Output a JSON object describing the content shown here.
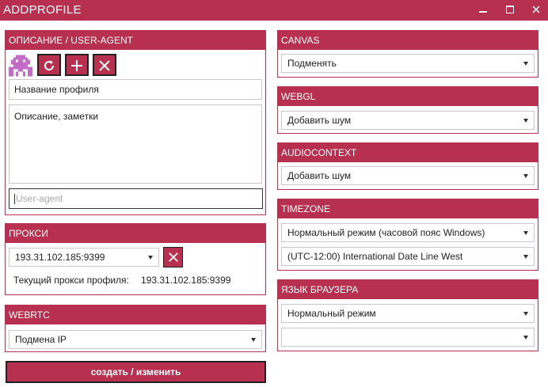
{
  "window": {
    "title": "ADDPROFILE",
    "minimize_glyph": "▬",
    "maximize_glyph": "☐",
    "close_glyph": "✕"
  },
  "description_panel": {
    "header": "ОПИСАНИЕ / USER-AGENT",
    "avatar_icon": "pixel-invader-icon",
    "profile_name_value": "Название профиля",
    "notes_value": "Описание, заметки",
    "user_agent_placeholder": "User-agent"
  },
  "proxy_panel": {
    "header": "ПРОКСИ",
    "selected": "193.31.102.185:9399",
    "current_label": "Текущий прокси профиля:",
    "current_value": "193.31.102.185:9399"
  },
  "webrtc_panel": {
    "header": "WEBRTC",
    "selected": "Подмена IP"
  },
  "canvas_panel": {
    "header": "CANVAS",
    "selected": "Подменять"
  },
  "webgl_panel": {
    "header": "WEBGL",
    "selected": "Добавить шум"
  },
  "audiocontext_panel": {
    "header": "AUDIOCONTEXT",
    "selected": "Добавить шум"
  },
  "timezone_panel": {
    "header": "TIMEZONE",
    "mode_selected": "Нормальный режим (часовой пояс Windows)",
    "zone_selected": "(UTC-12:00) International Date Line West"
  },
  "language_panel": {
    "header": "ЯЗЫК БРАУЗЕРА",
    "mode_selected": "Нормальный режим",
    "language_selected": ""
  },
  "submit_label": "создать / изменить",
  "colors": {
    "accent": "#b8304f",
    "avatar": "#c46bc8",
    "border": "#c8c8c8"
  }
}
